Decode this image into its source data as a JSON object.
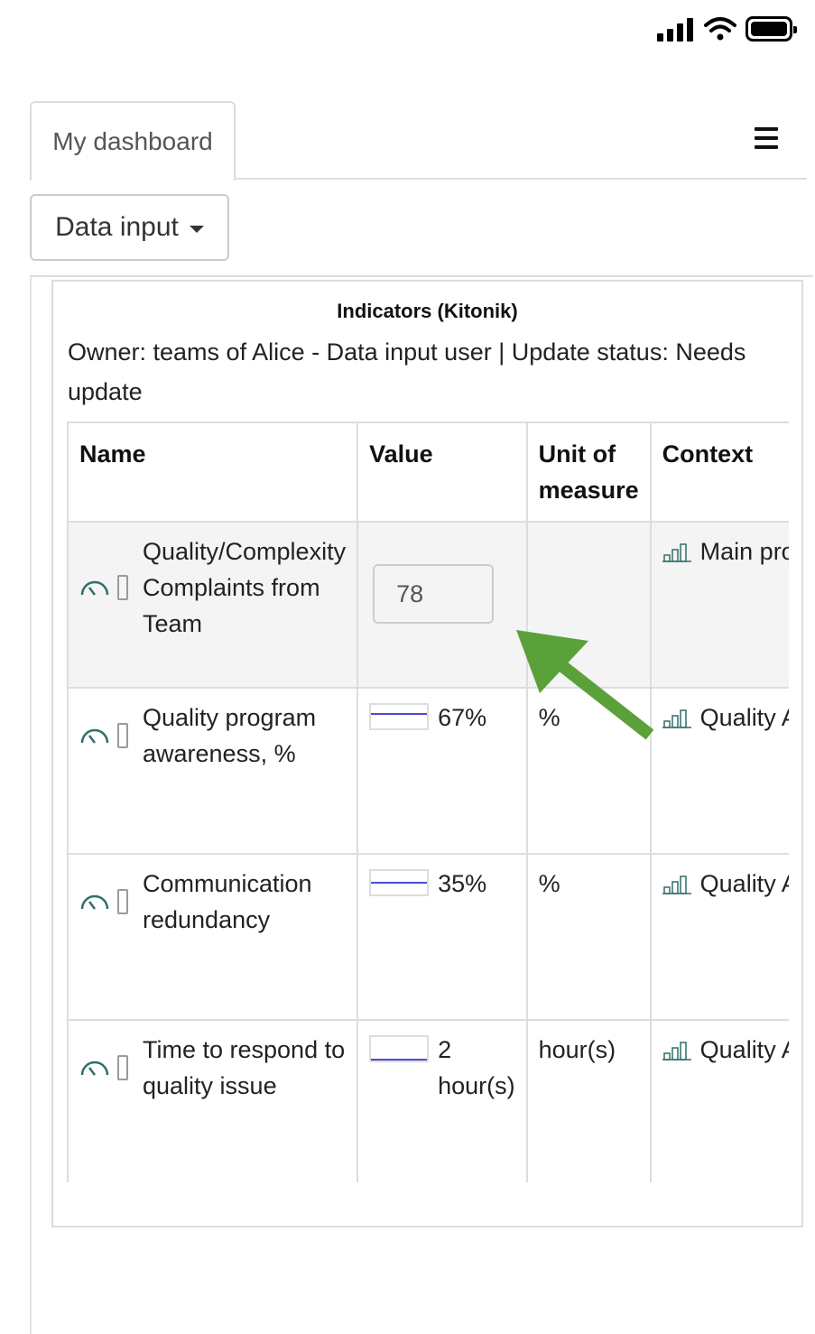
{
  "tabs": {
    "active_label": "My dashboard"
  },
  "header": {
    "menu_icon": "hamburger-menu-icon"
  },
  "dropdown": {
    "label": "Data input"
  },
  "panel": {
    "title": "Indicators (Kitonik)",
    "meta": "Owner: teams of Alice - Data input user | Update status: Needs update"
  },
  "table": {
    "columns": [
      "Name",
      "Value",
      "Unit of measure",
      "Context"
    ],
    "rows": [
      {
        "name": "Quality/Complexity Complaints from Team",
        "value": "78",
        "unit": "",
        "context": "Main product [Quality Score]"
      },
      {
        "name": "Quality program awareness, %",
        "value": "67%",
        "unit": "%",
        "context": "Quality Awareness [Quality Score]"
      },
      {
        "name": "Communication redundancy",
        "value": "35%",
        "unit": "%",
        "context": "Quality Awareness [Quality Score]"
      },
      {
        "name": "Time to respond to quality issue",
        "value": "2 hour(s)",
        "unit": "hour(s)",
        "context": "Quality Awareness [Quality Score]"
      }
    ]
  },
  "colors": {
    "accent_arrow": "#5ba13a",
    "mini_bar_line": "#4b4bd8",
    "gauge_icon": "#2f6f6a"
  }
}
